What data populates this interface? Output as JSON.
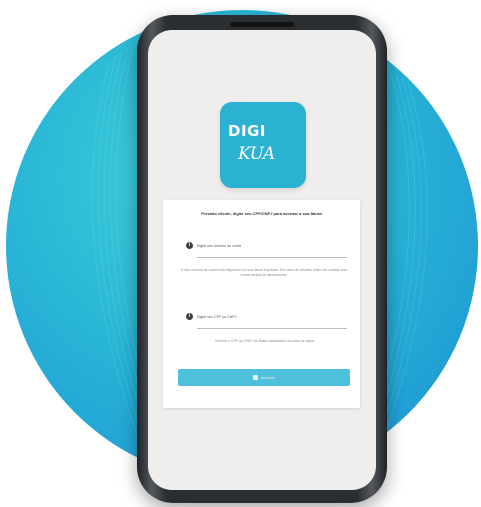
{
  "logo": {
    "line1": "DIGI",
    "line2": "KUA"
  },
  "form": {
    "intro": "Prezado cliente, digite seu CPF/CNPJ para acessar a sua fatura.",
    "field1_label": "Digite seu número de conta",
    "field1_hint": "O seu número de conta está disponível na sua fatura impressa. Em caso de dúvidas, entre em contato com nossa central de atendimento.",
    "field2_label": "Digite seu CPF ou CNPJ",
    "field2_hint": "Informe o CPF ou CNPJ do titular cadastrado na conta de água.",
    "submit_label": "Acessar"
  },
  "colors": {
    "brand": "#2bb2d2",
    "button": "#4ec0dc",
    "circle": "#29b5d6"
  },
  "icons": [
    "info-icon",
    "lock-icon"
  ]
}
